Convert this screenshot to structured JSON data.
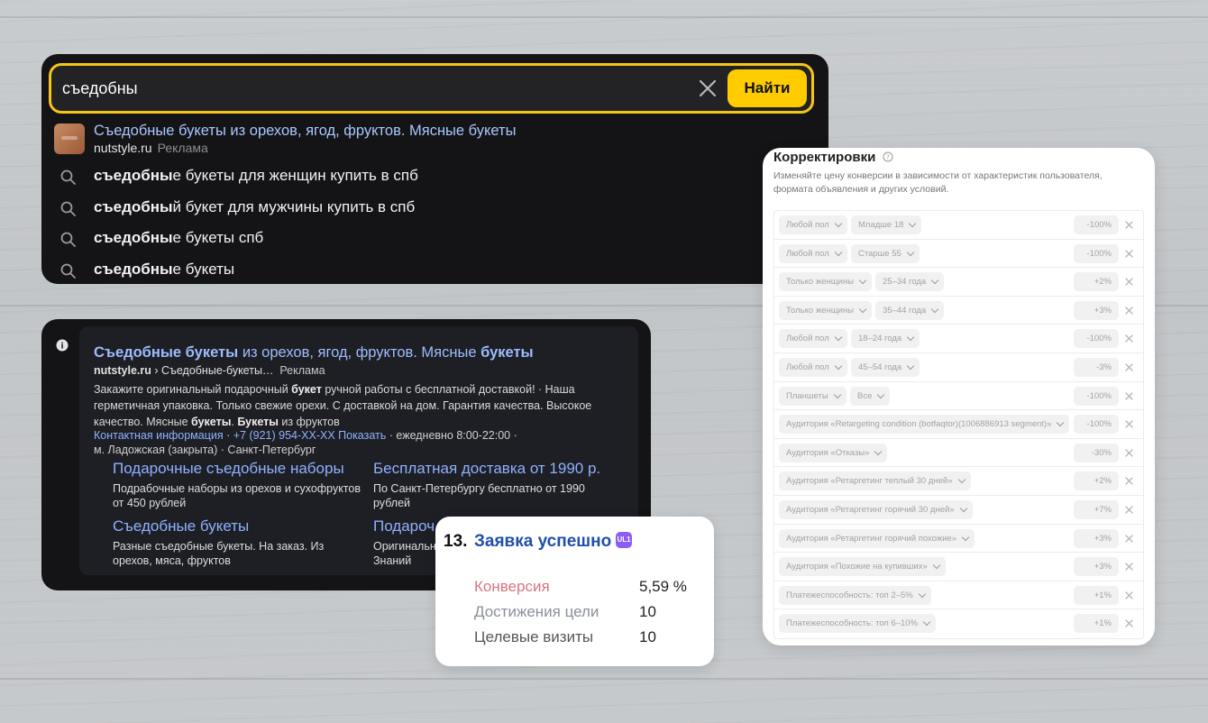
{
  "search": {
    "query": "съедобны",
    "button_label": "Найти",
    "ad_suggestion": {
      "title": "Съедобные букеты из орехов, ягод, фруктов. Мясные букеты",
      "domain": "nutstyle.ru",
      "label": "Реклама"
    },
    "suggestions": [
      {
        "bold": "съедобны",
        "rest": "е букеты для женщин купить в спб"
      },
      {
        "bold": "съедобны",
        "rest": "й букет для мужчины купить в спб"
      },
      {
        "bold": "съедобны",
        "rest": "е букеты спб"
      },
      {
        "bold": "съедобны",
        "rest": "е букеты"
      }
    ]
  },
  "ad": {
    "title_bold_1": "Съедобные букеты",
    "title_mid": " из орехов, ягод, фруктов. Мясные ",
    "title_bold_2": "букеты",
    "url_domain": "nutstyle.ru",
    "url_path": " › Съедобные-букеты…",
    "url_label": "Реклама",
    "desc_1": "Закажите оригинальный подарочный ",
    "desc_b1": "букет",
    "desc_2": " ручной работы с бесплатной доставкой! · Наша герметичная упаковка. Только свежие орехи. С доставкой на дом. Гарантия качества. Высокое качество. Мясные ",
    "desc_b2": "букеты",
    "desc_3": ". ",
    "desc_b3": "Букеты",
    "desc_4": " из фруктов",
    "contacts_link": "Контактная информация",
    "phone": "+7 (921) 954-XX-XX Показать",
    "hours": "ежедневно 8:00-22:00",
    "address": "м. Ладожская (закрыта) · Санкт-Петербург",
    "sitelinks": [
      {
        "title": "Подарочные съедобные наборы",
        "desc": "Подрабочные наборы из орехов и сухофруктов от 450 рублей"
      },
      {
        "title": "Бесплатная доставка от 1990 р.",
        "desc": "По Санкт-Петербургу бесплатно от 1990 рублей"
      },
      {
        "title": "Съедобные букеты",
        "desc": "Разные съедобные букеты. На заказ. Из орехов, мяса, фруктов"
      },
      {
        "title": "Подароч",
        "desc": "Оригинальн Знаний"
      }
    ]
  },
  "conversion": {
    "number": "13.",
    "title": "Заявка успешно",
    "badge": "UL1",
    "rows": [
      {
        "label": "Конверсия",
        "value": "5,59 %",
        "color": "#d9737f"
      },
      {
        "label": "Достижения цели",
        "value": "10",
        "color": "#8a8f99"
      },
      {
        "label": "Целевые визиты",
        "value": "10",
        "color": "#555555"
      }
    ]
  },
  "adjustments": {
    "title": "Корректировки",
    "subtitle": "Изменяйте цену конверсии в зависимости от характеристик пользователя, формата объявления и других условий.",
    "rows": [
      {
        "chips": [
          "Любой пол",
          "Младше 18"
        ],
        "pct": "-100%"
      },
      {
        "chips": [
          "Любой пол",
          "Старше 55"
        ],
        "pct": "-100%"
      },
      {
        "chips": [
          "Только женщины",
          "25–34 года"
        ],
        "pct": "+2%"
      },
      {
        "chips": [
          "Только женщины",
          "35–44 года"
        ],
        "pct": "+3%"
      },
      {
        "chips": [
          "Любой пол",
          "18–24 года"
        ],
        "pct": "-100%"
      },
      {
        "chips": [
          "Любой пол",
          "45–54 года"
        ],
        "pct": "-3%"
      },
      {
        "chips": [
          "Планшеты",
          "Все"
        ],
        "pct": "-100%"
      },
      {
        "chips": [
          "Аудитория «Retargeting condition (botfaqtor)(1006886913 segment)»"
        ],
        "pct": "-100%"
      },
      {
        "chips": [
          "Аудитория «Отказы»"
        ],
        "pct": "-30%"
      },
      {
        "chips": [
          "Аудитория «Ретаргетинг теплый 30 дней»"
        ],
        "pct": "+2%"
      },
      {
        "chips": [
          "Аудитория «Ретаргетинг горячий 30 дней»"
        ],
        "pct": "+7%"
      },
      {
        "chips": [
          "Аудитория «Ретаргетинг горячий похожие»"
        ],
        "pct": "+3%"
      },
      {
        "chips": [
          "Аудитория «Похожие на купивших»"
        ],
        "pct": "+3%"
      },
      {
        "chips": [
          "Платежеспособность: топ 2–5%"
        ],
        "pct": "+1%"
      },
      {
        "chips": [
          "Платежеспособность: топ 6–10%"
        ],
        "pct": "+1%"
      }
    ]
  }
}
